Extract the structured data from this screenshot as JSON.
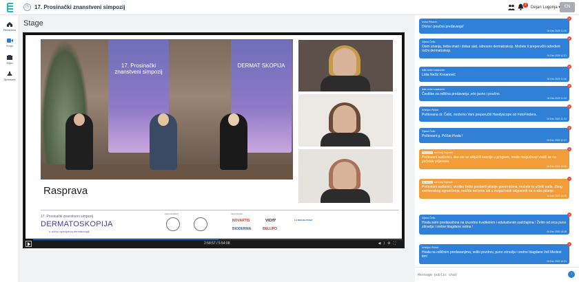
{
  "app": {
    "title": "17. Prosinački znanstveni simpozij",
    "title_icon": "circle-icon"
  },
  "topbar": {
    "notifications_count": "2",
    "user_name": "Dejan Lugonja",
    "language": "EN",
    "icons": [
      "people-icon",
      "bell-icon"
    ]
  },
  "nav": [
    {
      "label": "Reception",
      "icon": "home-icon"
    },
    {
      "label": "Stage",
      "icon": "video-icon",
      "active": true
    },
    {
      "label": "Expo",
      "icon": "expo-icon"
    },
    {
      "label": "Sponsors",
      "icon": "sponsors-icon"
    }
  ],
  "stage": {
    "title": "Stage",
    "slide": {
      "heading": "Rasprava",
      "event_line1": "17. Prosinački znanstveni simpozij",
      "event_brand": "DERMATOSKOPIJA",
      "event_line3": "u općoj i specijalnoj dermatologiji",
      "organizers_label": "ORGANIZERS",
      "sponsors_label": "SPONSORS",
      "banner_text": "17. Prosinački znanstveni simpozij",
      "banner_brand": "DERMAT SKOPIJA",
      "sponsors": [
        "NOVARTIS",
        "VICHY",
        "LA ROCHE-POSAY",
        "BIODERMA",
        "BELUPO"
      ]
    },
    "player": {
      "time": "2:58:57 / 5:54:08",
      "progress_pct": 50.2
    },
    "colors": {
      "accent": "#2e7bcf",
      "chat_blue": "#2f80d6",
      "chat_orange": "#f39c3a"
    }
  },
  "chat": {
    "placeholder": "Message public chat",
    "messages": [
      {
        "author": "Ivana Prkacin:",
        "text": "Divna i poučna predavanja!",
        "time": "04 Dec 2020 11:20",
        "color": "blue"
      },
      {
        "author": "Dijana Čelić:",
        "text": "Osim znanja, treba imati i dobar alat, odnosno dermatoskop. Možete li preporučiti određeni ručni dermatoskop.",
        "time": "04 Dec 2020 11:31",
        "color": "blue"
      },
      {
        "author": "lidia nežić kosanović:",
        "text": "Lidia Nežić Kosanović",
        "time": "04 Dec 2020 11:36",
        "color": "blue"
      },
      {
        "author": "lidia nežić kosanović:",
        "text": "Čestitke za odlična predavanja ,vrlo jasno i poučno.",
        "time": "04 Dec 2020 11:40",
        "color": "blue"
      },
      {
        "author": "Kristijan Piččar:",
        "text": "Poštovana dr. Čelić, možemo Vam preporučiti Handyscope od FotoFindera.",
        "time": "04 Dec 2020 12:22",
        "color": "blue"
      },
      {
        "author": "Dijana Čelić:",
        "text": "Poštovani g. Piččar,Hvala !",
        "time": "04 Dec 2020 12:47",
        "color": "blue"
      },
      {
        "author": "Iva Krolj Vujnović",
        "moderator": "Moderator",
        "text": "Poštovani sudionici, ako ste se uključili kasnije u program, imate mogućnost vratiti se na početak prijenosa.",
        "time": "04 Dec 2020 13:28",
        "color": "orange"
      },
      {
        "author": "Iva Krolj Vujnović",
        "moderator": "Moderator",
        "text": "Poštovani sudionici, ukoliko želite postaviti pitanje govornicima, možete to učiniti sada. Zbog vremenskog ograničenja, možda nećemo biti u mogućnosti odgovoriti na svako pitanje.",
        "time": "04 Dec 2020 13:48",
        "color": "orange"
      },
      {
        "author": "Dijana Čelić:",
        "text": "Hvala svim predavačima na izuzetno kvalitetnim i edukativnim sadržajima ! Želim od srca puno zdravlja i sretne blagdane svima !",
        "time": "04 Dec 2020 14:28",
        "color": "blue"
      },
      {
        "author": "Kristijan Piččar:",
        "text": "Hvala na odličnim predavanjima, veliki pozdrav, puno zdravlja i sretne blagdane želi Medest tim!",
        "time": "04 Dec 2020 14:31",
        "color": "blue"
      }
    ]
  }
}
